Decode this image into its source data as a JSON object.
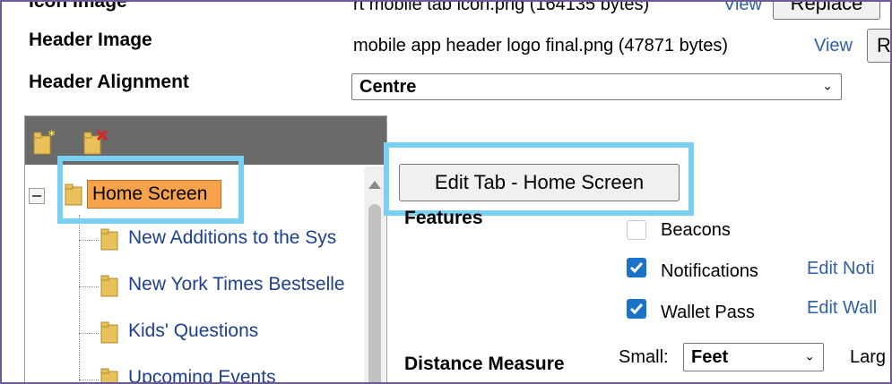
{
  "header": {
    "icon_image_label": "Icon Image",
    "icon_image_file": "rt mobile tab icon.png (164135 bytes)",
    "icon_view_link": "View",
    "replace_button": "Replace",
    "header_image_label": "Header Image",
    "header_image_file": "mobile app header logo final.png (47871 bytes)",
    "header_view_link": "View",
    "header_replace_button": "R",
    "header_alignment_label": "Header Alignment",
    "header_alignment_value": "Centre"
  },
  "tree": {
    "root": "Home Screen",
    "items": [
      "New Additions to the Sys",
      "New York Times Bestselle",
      "Kids' Questions",
      "Upcoming Events"
    ]
  },
  "editor": {
    "edit_tab_button": "Edit Tab - Home Screen",
    "features_label": "Features",
    "features": [
      {
        "label": "Beacons",
        "checked": false,
        "link": ""
      },
      {
        "label": "Notifications",
        "checked": true,
        "link": "Edit Noti"
      },
      {
        "label": "Wallet Pass",
        "checked": true,
        "link": "Edit Wall"
      }
    ],
    "distance_label": "Distance Measure",
    "small_label": "Small:",
    "small_value": "Feet",
    "large_label": "Larg"
  },
  "colors": {
    "frame": "#6e5a96",
    "highlight": "#7ad0f3",
    "tree_selected": "#f6a24a",
    "toolbar": "#6a6a6a",
    "link": "#2f5fa5"
  }
}
